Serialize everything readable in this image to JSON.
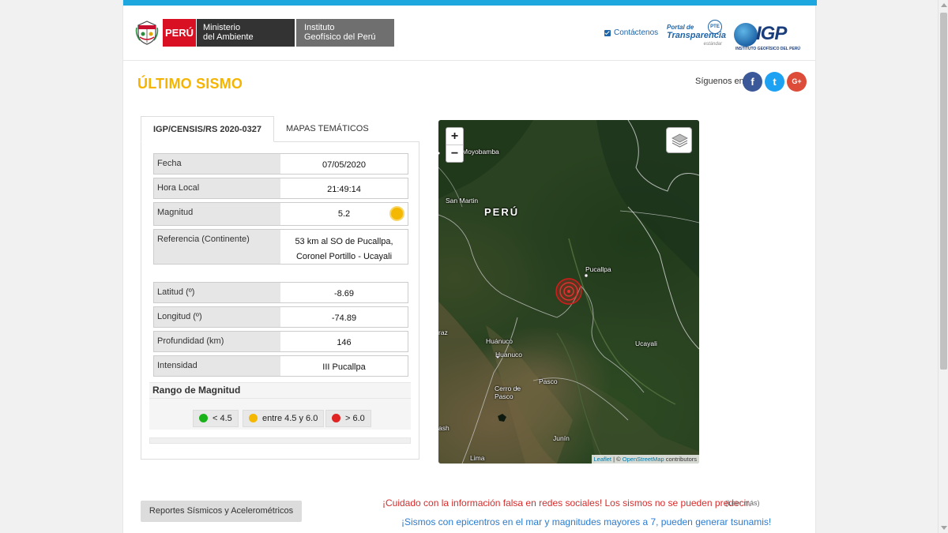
{
  "header": {
    "gov_peru": "PERÚ",
    "gov_ministry_line1": "Ministerio",
    "gov_ministry_line2": "del Ambiente",
    "gov_institute_line1": "Instituto",
    "gov_institute_line2": "Geofísico del Perú",
    "contact_label": "Contáctenos",
    "transparency_line1": "Portal de",
    "transparency_line2": "Transparencia",
    "transparency_line3": "estándar",
    "transparency_badge": "PTE",
    "igp_logo": "IGP",
    "igp_subtitle": "INSTITUTO GEOFÍSICO DEL PERÚ"
  },
  "page_title": "ÚLTIMO SISMO",
  "social": {
    "follow_label": "Síguenos en:",
    "facebook": "f",
    "twitter": "t",
    "googleplus": "G+"
  },
  "tabs": [
    {
      "label": "IGP/CENSIS/RS  2020-0327"
    },
    {
      "label": "MAPAS TEMÁTICOS"
    }
  ],
  "quake": {
    "fecha_label": "Fecha",
    "fecha": "07/05/2020",
    "hora_label": "Hora Local",
    "hora": "21:49:14",
    "magnitud_label": "Magnitud",
    "magnitud": "5.2",
    "referencia_label": "Referencia (Continente)",
    "referencia": "53 km al SO de Pucallpa, Coronel Portillo - Ucayali",
    "latitud_label": "Latitud (º)",
    "latitud": "-8.69",
    "longitud_label": "Longitud (º)",
    "longitud": "-74.89",
    "profundidad_label": "Profundidad (km)",
    "profundidad": "146",
    "intensidad_label": "Intensidad",
    "intensidad": "III Pucallpa"
  },
  "magnitude_range": {
    "title": "Rango de Magnitud",
    "items": [
      {
        "label": "< 4.5",
        "color": "#19b219"
      },
      {
        "label": "entre 4.5 y 6.0",
        "color": "#f5b800"
      },
      {
        "label": "> 6.0",
        "color": "#e02424"
      }
    ]
  },
  "map": {
    "zoom_in": "+",
    "zoom_out": "−",
    "labels": {
      "moyobamba": "Moyobamba",
      "san_martin": "San Martin",
      "peru": "PERÚ",
      "pucallpa": "Pucallpa",
      "ucayali": "Ucayali",
      "huanuco_region": "Huánuco",
      "huanuco_city": "Huanuco",
      "pasco": "Pasco",
      "cerro_de_pasco_1": "Cerro de",
      "cerro_de_pasco_2": "Pasco",
      "junin": "Junín",
      "lima": "Lima",
      "ancash_fragment": "ash",
      "huaraz_fragment": "raz"
    },
    "attribution": {
      "leaflet": "Leaflet",
      "sep": " | © ",
      "osm": "OpenStreetMap",
      "contrib": " contributors"
    }
  },
  "footer": {
    "reports_button": "Reportes Sísmicos y Acelerométricos",
    "warning": "¡Cuidado con la información falsa en redes sociales! Los sismos no se pueden predecir.",
    "warning_more": "(Leer más)",
    "tsunami": "¡Sismos con epicentros en el mar y magnitudes mayores a 7, pueden generar tsunamis!"
  }
}
